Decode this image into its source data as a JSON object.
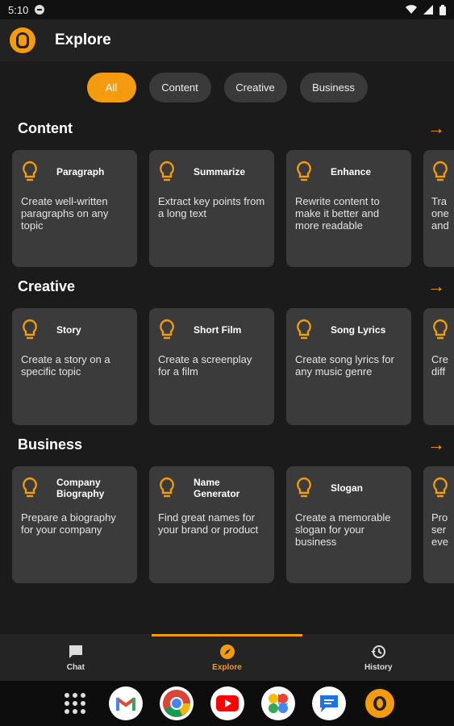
{
  "status": {
    "time": "5:10"
  },
  "app": {
    "title": "Explore"
  },
  "filters": [
    "All",
    "Content",
    "Creative",
    "Business"
  ],
  "sections": [
    {
      "title": "Content",
      "cards": [
        {
          "title": "Paragraph",
          "desc": "Create well-written paragraphs on any topic"
        },
        {
          "title": "Summarize",
          "desc": "Extract key points from a long text"
        },
        {
          "title": "Enhance",
          "desc": "Rewrite content to make it better and more readable"
        }
      ],
      "peek": [
        "Tra",
        "one",
        "and"
      ]
    },
    {
      "title": "Creative",
      "cards": [
        {
          "title": "Story",
          "desc": "Create a story on a specific topic"
        },
        {
          "title": "Short Film",
          "desc": "Create a screenplay for a film"
        },
        {
          "title": "Song Lyrics",
          "desc": "Create song lyrics for any music genre"
        }
      ],
      "peek": [
        "Cre",
        "diff"
      ]
    },
    {
      "title": "Business",
      "cards": [
        {
          "title": "Company Biography",
          "desc": "Prepare a biography for your company"
        },
        {
          "title": "Name Generator",
          "desc": "Find great names for your brand or product"
        },
        {
          "title": "Slogan",
          "desc": "Create a memorable slogan for your business"
        }
      ],
      "peek": [
        "Pro",
        "ser",
        "eve"
      ]
    }
  ],
  "nav": {
    "chat": "Chat",
    "explore": "Explore",
    "history": "History"
  },
  "colors": {
    "accent": "#f59b0f",
    "background": "#1b1b1b",
    "card": "#3b3b3b"
  },
  "dock_apps": [
    "apps-grid-icon",
    "gmail-icon",
    "chrome-icon",
    "youtube-icon",
    "photos-icon",
    "messages-icon",
    "brain-app-icon"
  ]
}
